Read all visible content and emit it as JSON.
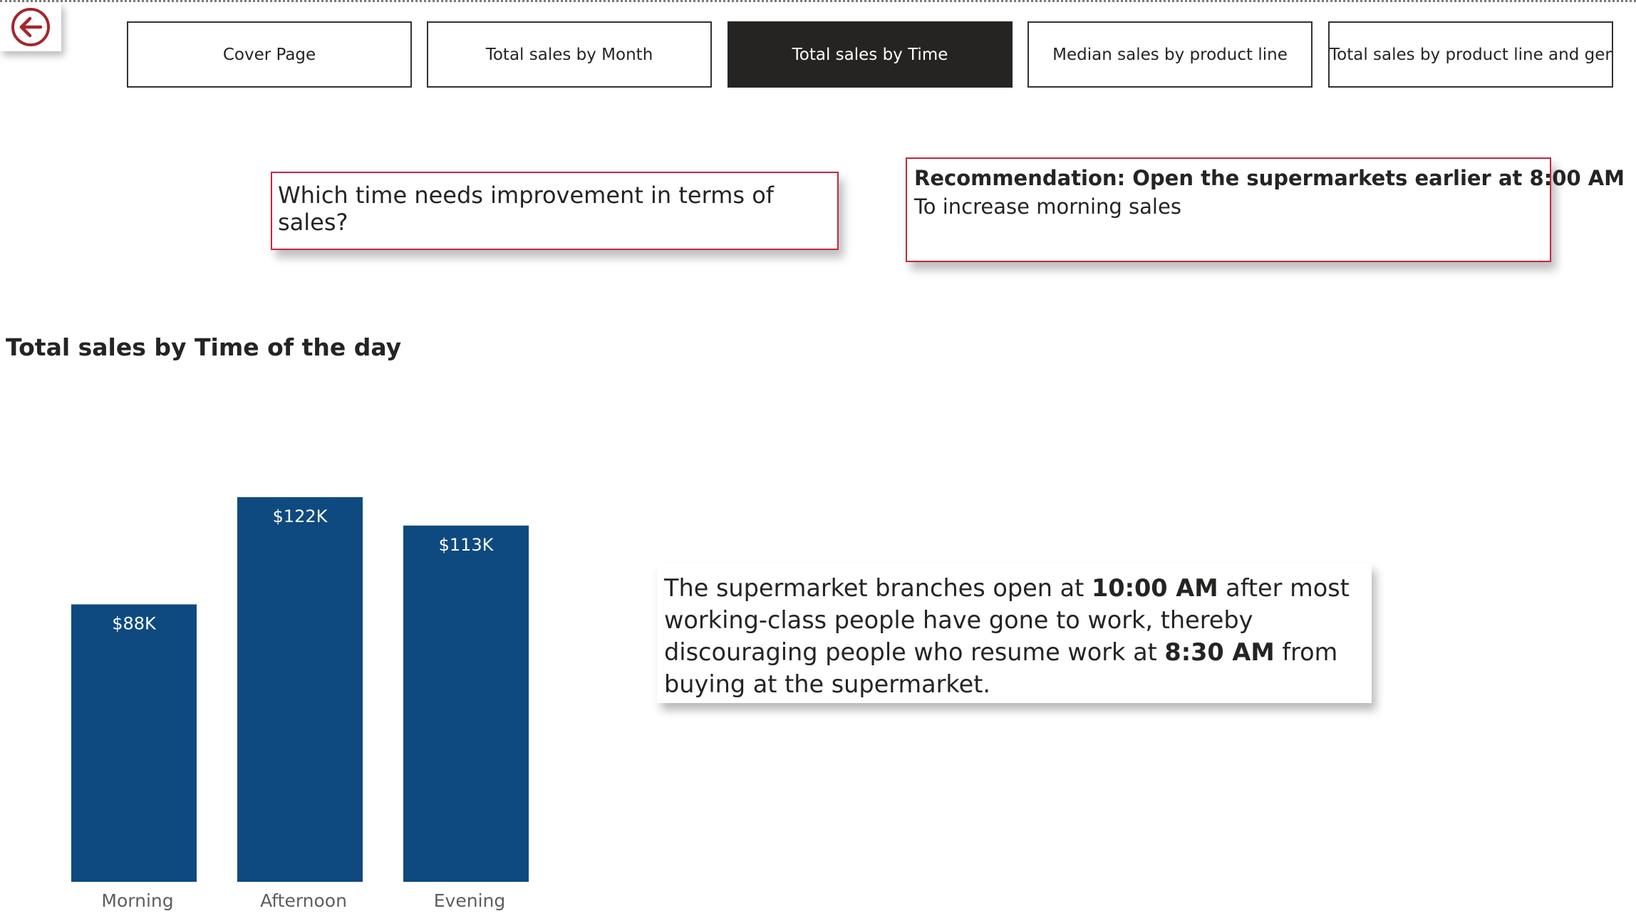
{
  "nav": {
    "back_icon": "circle-arrow-left-icon",
    "accent_color": "#a4262c",
    "buttons": [
      {
        "label": "Cover Page",
        "active": false
      },
      {
        "label": "Total sales by Month",
        "active": false
      },
      {
        "label": "Total sales by Time",
        "active": true
      },
      {
        "label": "Median sales by product line",
        "active": false
      },
      {
        "label": "Total sales by product line and gender",
        "active": false
      }
    ]
  },
  "question": {
    "text": "Which time needs improvement in terms of sales?"
  },
  "recommendation": {
    "title": "Recommendation: Open the supermarkets earlier at 8:00 AM",
    "subtitle": "To increase morning sales"
  },
  "chart_data": {
    "type": "bar",
    "title": "Total sales by Time of the day",
    "categories": [
      "Morning",
      "Afternoon",
      "Evening"
    ],
    "values": [
      88,
      122,
      113
    ],
    "value_unit": "K (USD)",
    "data_labels": [
      "$88K",
      "$122K",
      "$113K"
    ],
    "bar_color": "#0e4a80",
    "xlabel": "",
    "ylabel": "",
    "ylim": [
      0,
      122
    ],
    "grid": false,
    "legend": "none"
  },
  "insight": {
    "part1": "The supermarket branches open at ",
    "bold1": "10:00 AM",
    "part2": " after most working-class people have gone to work, thereby discouraging people who resume work at ",
    "bold2": "8:30 AM",
    "part3": " from buying at the supermarket."
  }
}
